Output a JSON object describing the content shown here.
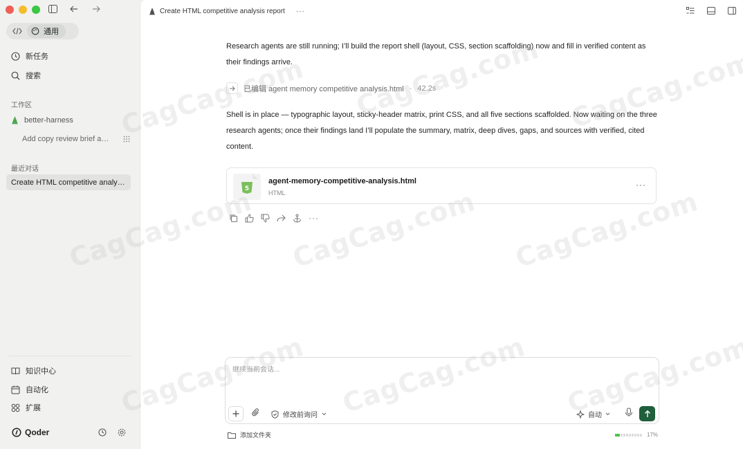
{
  "sidebar": {
    "mode_general_label": "通用",
    "nav": {
      "new_task": "新任务",
      "search": "搜索"
    },
    "workspace_label": "工作区",
    "project": "better-harness",
    "project_sub_item": "Add copy review brief acti...",
    "recent_label": "最近对话",
    "recent_chat": "Create HTML competitive analys...",
    "bottom_nav": {
      "knowledge": "知识中心",
      "automation": "自动化",
      "extensions": "扩展"
    },
    "brand": "Qoder"
  },
  "header": {
    "title": "Create HTML competitive analysis report",
    "more": "···"
  },
  "conversation": {
    "msg1": "Research agents are still running; I’ll build the report shell (layout, CSS, section scaffolding) now and fill in verified content as their findings arrive.",
    "edit_label": "已编辑 agent memory competitive analysis.html",
    "edit_sep": "·",
    "edit_time": "42.2s",
    "msg2": "Shell is in place — typographic layout, sticky-header matrix, print CSS, and all five sections scaffolded. Now waiting on the three research agents; once their findings land I’ll populate the summary, matrix, deep dives, gaps, and sources with verified, cited content.",
    "file": {
      "name": "agent-memory-competitive-analysis.html",
      "type": "HTML",
      "more": "···"
    },
    "actions_more": "···"
  },
  "composer": {
    "placeholder": "继续当前会话...",
    "approval_mode": "修改前询问",
    "model_mode": "自动"
  },
  "footer": {
    "add_folder": "添加文件夹",
    "context_usage_label": "17%",
    "context_usage_fraction": 0.17
  },
  "watermark_text": "CagCag.com",
  "colors": {
    "send_button": "#1f5f3b",
    "html5_badge": "#7bbf5a",
    "context_fill": "#52c452",
    "project_icon": "#4caf50"
  }
}
